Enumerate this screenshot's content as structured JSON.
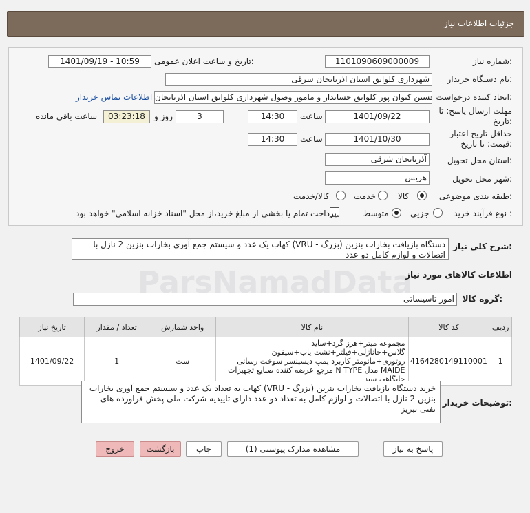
{
  "header": {
    "title": "جزئیات اطلاعات نیاز"
  },
  "form": {
    "need_number_label": "شماره نیاز:",
    "need_number": "1101090609000009",
    "announce_label": "تاریخ و ساعت اعلان عمومی:",
    "announce_value": "1401/09/19 - 10:59",
    "buyer_label": "نام دستگاه خریدار:",
    "buyer_value": "شهرداری کلوانق استان اذربایجان شرقی",
    "creator_label": "ایجاد کننده درخواست:",
    "creator_value": "حسین  کیوان پور کلوانق حسابدار و مامور وصول شهرداری کلوانق استان اذربایجان",
    "contact_link": "اطلاعات تماس خریدار",
    "reply_deadline_label": "مهلت ارسال پاسخ: تا",
    "reply_deadline_label2": "تاریخ:",
    "reply_date": "1401/09/22",
    "time_label": "ساعت",
    "reply_time": "14:30",
    "days_value": "3",
    "days_label": "روز و",
    "remaining_value": "03:23:18",
    "remaining_label": "ساعت باقی مانده",
    "validity_label": "حداقل تاریخ اعتبار",
    "validity_label2": "قیمت: تا تاریخ:",
    "validity_date": "1401/10/30",
    "validity_time": "14:30",
    "province_label": "استان محل تحویل:",
    "province_value": "آذربایجان شرقی",
    "city_label": "شهر محل تحویل:",
    "city_value": "هریس",
    "category_label": "طبقه بندی موضوعی:",
    "category_options": [
      "کالا",
      "خدمت",
      "کالا/خدمت"
    ],
    "process_label": "نوع فرآیند خرید :",
    "process_options": [
      "جزیی",
      "متوسط"
    ],
    "payment_note": "پرداخت تمام یا بخشی از مبلغ خرید،از محل \"اسناد خزانه اسلامی\" خواهد بود."
  },
  "summary": {
    "label": "شرح کلی نیاز:",
    "text": "دستگاه  بازیافت بخارات بنزین (بزرگ - VRU) کهاب  یک عدد و سیستم جمع آوری بخارات بنزین 2 نازل  با اتصالات و لوازم کامل دو عدد"
  },
  "goods": {
    "section_title": "اطلاعات کالاهای مورد نیاز",
    "group_label": "گروه کالا:",
    "group_value": "امور تاسیساتی",
    "columns": [
      "ردیف",
      "کد کالا",
      "نام کالا",
      "واحد شمارش",
      "تعداد / مقدار",
      "تاریخ نیاز"
    ],
    "rows": [
      {
        "index": "1",
        "code": "4164280149110001",
        "name": "مجموعه میتر+هرز گرد+ساید گلاس+جانازلی+فیلتر+نشت یاب+سیفون روتوری+مانومتر کاربرد پمپ دیسپنسر سوخت رسانی MAIDE مدل N TYPE مرجع عرضه کننده صنایع تجهیزات جایگاهی سبز",
        "unit": "ست",
        "qty": "1",
        "date": "1401/09/22"
      }
    ]
  },
  "notes": {
    "label": "توضیحات خریدار:",
    "text": "خرید دستگاه  بازیافت بخارات بنزین (بزرگ - VRU) کهاب  به تعداد یک عدد و سیستم جمع آوری بخارات بنزین 2 نازل  با اتصالات و لوازم کامل   به تعداد دو عدد دارای تاییدیه  شرکت ملی پخش فراورده های نفتی تبریز"
  },
  "buttons": {
    "reply": "پاسخ به نیاز",
    "attachments": "مشاهده مدارک پیوستی (1)",
    "print": "چاپ",
    "back": "بازگشت",
    "exit": "خروج"
  },
  "watermark": {
    "text": "ParsNamadData"
  }
}
